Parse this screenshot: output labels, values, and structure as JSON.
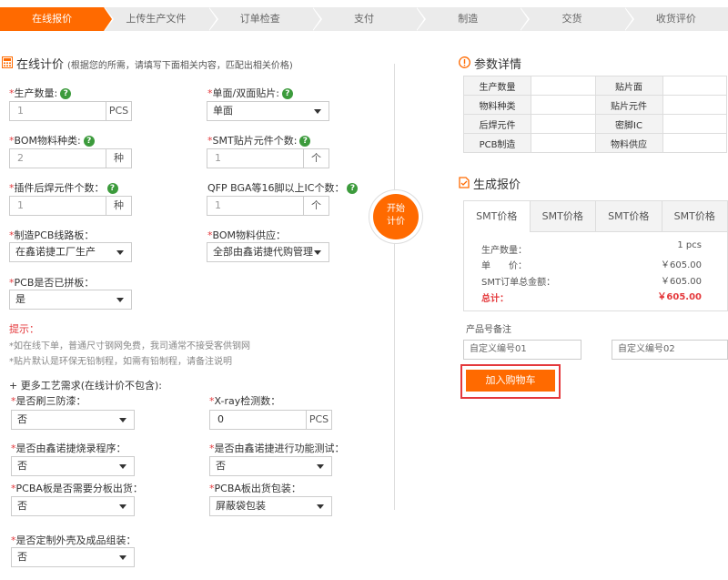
{
  "steps": [
    "在线报价",
    "上传生产文件",
    "订单检查",
    "支付",
    "制造",
    "交货",
    "收货评价"
  ],
  "left": {
    "title": "在线计价",
    "subtitle": "(根据您的所需，请填写下面相关内容，匹配出相关价格)",
    "fields": {
      "qty_label": "生产数量:",
      "qty_value": "1",
      "qty_unit": "PCS",
      "side_label": "单面/双面贴片:",
      "side_value": "单面",
      "bom_label": "BOM物料种类:",
      "bom_value": "2",
      "bom_unit": "种",
      "smt_label": "SMT贴片元件个数:",
      "smt_value": "1",
      "smt_unit": "个",
      "plugin_label": "插件后焊元件个数：",
      "plugin_value": "1",
      "plugin_unit": "种",
      "qfp_label": "QFP BGA等16脚以上IC个数：",
      "qfp_value": "1",
      "qfp_unit": "个",
      "pcb_label": "制造PCB线路板：",
      "pcb_value": "在鑫诺捷工厂生产",
      "supply_label": "BOM物料供应：",
      "supply_value": "全部由鑫诺捷代购管理",
      "panel_label": "PCB是否已拼板：",
      "panel_value": "是"
    },
    "tips": {
      "title": "提示：",
      "line1": "*如在线下单，普通尺寸钢网免费，我司通常不接受客供钢网",
      "line2": "*贴片默认是环保无铅制程，如需有铅制程，请备注说明"
    },
    "more": {
      "title": "+ 更多工艺需求(在线计价不包含):",
      "coat_label": "是否刷三防漆：",
      "coat_value": "否",
      "xray_label": "X-ray检测数：",
      "xray_value": "0",
      "xray_unit": "PCS",
      "burn_label": "是否由鑫诺捷烧录程序：",
      "burn_value": "否",
      "test_label": "是否由鑫诺捷进行功能测试：",
      "test_value": "否",
      "split_label": "PCBA板是否需要分板出货：",
      "split_value": "否",
      "pack_label": "PCBA板出货包装：",
      "pack_value": "屏蔽袋包装",
      "shell_label": "是否定制外壳及成品组装：",
      "shell_value": "否"
    }
  },
  "start_button": {
    "line1": "开始",
    "line2": "计价"
  },
  "params": {
    "title": "参数详情",
    "rows": [
      [
        "生产数量",
        "",
        "贴片面",
        ""
      ],
      [
        "物料种类",
        "",
        "贴片元件",
        ""
      ],
      [
        "后焊元件",
        "",
        "密脚IC",
        ""
      ],
      [
        "PCB制造",
        "",
        "物料供应",
        ""
      ]
    ]
  },
  "quote": {
    "title": "生成报价",
    "tabs": [
      "SMT价格",
      "SMT价格",
      "SMT价格",
      "SMT价格"
    ],
    "qty_label": "生产数量：",
    "qty_value": "1 pcs",
    "unit_label": "单　　价：",
    "unit_value": "￥605.00",
    "smt_total_label": "SMT订单总金额：",
    "smt_total_value": "￥605.00",
    "total_label": "总计：",
    "total_value": "￥605.00"
  },
  "notes": {
    "label": "产品号备注",
    "field1": "自定义编号01",
    "field2": "自定义编号02"
  },
  "cart_button": "加入购物车",
  "colors": {
    "accent": "#ff6a00",
    "required": "#e4393c",
    "help": "#3c9b3c"
  }
}
